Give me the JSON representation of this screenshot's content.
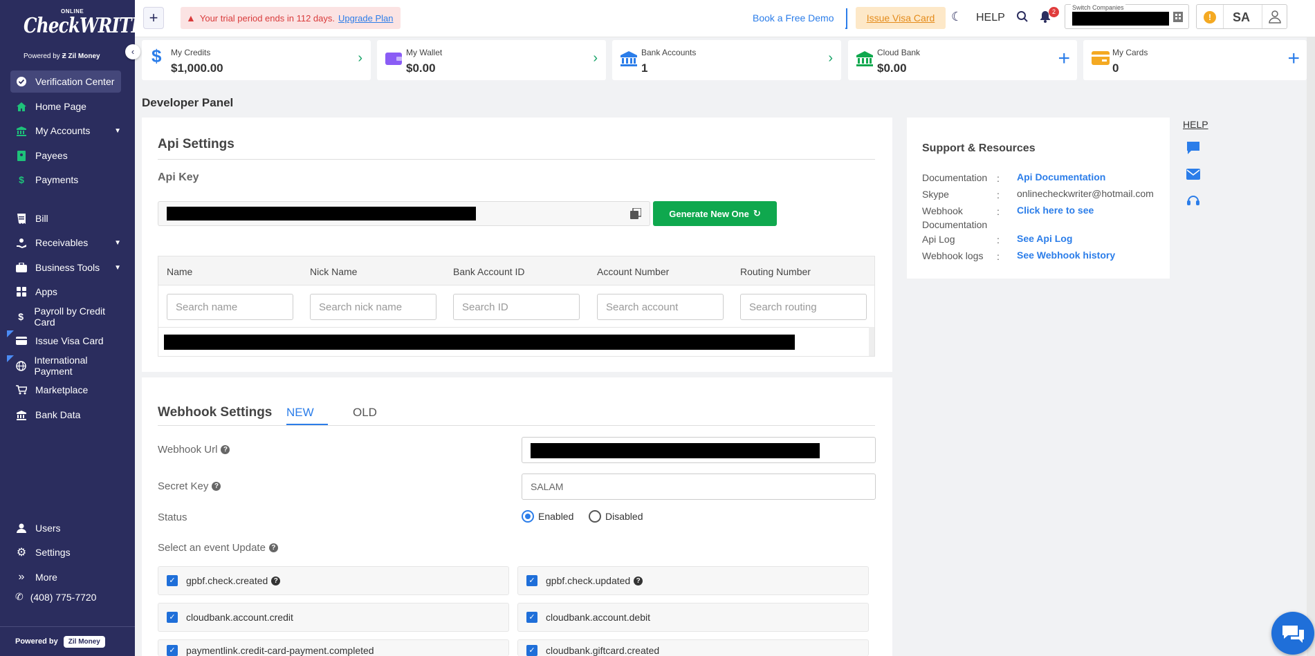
{
  "logo": {
    "online": "ONLINE",
    "brand": "CheckWRITER",
    "powered_by": "Powered by",
    "company": "Zil Money"
  },
  "sidebar": {
    "items": [
      {
        "label": "Verification Center",
        "icon": "check-circle-icon"
      },
      {
        "label": "Home Page",
        "icon": "home-icon"
      },
      {
        "label": "My Accounts",
        "icon": "bank-icon"
      },
      {
        "label": "Payees",
        "icon": "payee-icon"
      },
      {
        "label": "Payments",
        "icon": "dollar-icon"
      },
      {
        "label": "Bill",
        "icon": "bill-icon"
      },
      {
        "label": "Receivables",
        "icon": "receivables-icon"
      },
      {
        "label": "Business Tools",
        "icon": "briefcase-icon"
      },
      {
        "label": "Apps",
        "icon": "apps-icon"
      },
      {
        "label": "Payroll by Credit Card",
        "icon": "dollar-icon"
      },
      {
        "label": "Issue Visa Card",
        "icon": "card-icon"
      },
      {
        "label": "International Payment",
        "icon": "globe-icon"
      },
      {
        "label": "Marketplace",
        "icon": "cart-icon"
      },
      {
        "label": "Bank Data",
        "icon": "bank-icon"
      },
      {
        "label": "Users",
        "icon": "user-icon"
      },
      {
        "label": "Settings",
        "icon": "gear-icon"
      },
      {
        "label": "More",
        "icon": "double-chevron-icon"
      }
    ],
    "phone": "(408) 775-7720",
    "footer_powered": "Powered by",
    "footer_company": "Zil Money"
  },
  "topbar": {
    "trial_text": "Your trial period ends in 112 days.",
    "upgrade_link": "Upgrade Plan",
    "demo_link": "Book a Free Demo",
    "visa_button": "Issue Visa Card",
    "help": "HELP",
    "notification_count": "2",
    "switch_label": "Switch Companies",
    "initials": "SA",
    "alert": "!"
  },
  "cards": [
    {
      "label": "My Credits",
      "value": "$1,000.00"
    },
    {
      "label": "My Wallet",
      "value": "$0.00"
    },
    {
      "label": "Bank Accounts",
      "value": "1"
    },
    {
      "label": "Cloud Bank",
      "value": "$0.00"
    },
    {
      "label": "My Cards",
      "value": "0"
    }
  ],
  "page_title": "Developer Panel",
  "api": {
    "title": "Api Settings",
    "key_label": "Api Key",
    "generate_button": "Generate New One",
    "columns": [
      "Name",
      "Nick Name",
      "Bank Account ID",
      "Account Number",
      "Routing Number"
    ],
    "placeholders": [
      "Search name",
      "Search nick name",
      "Search ID",
      "Search account",
      "Search routing"
    ]
  },
  "webhook": {
    "title": "Webhook Settings",
    "tab_new": "NEW",
    "tab_old": "OLD",
    "url_label": "Webhook Url",
    "secret_label": "Secret Key",
    "secret_value": "SALAM",
    "status_label": "Status",
    "enabled": "Enabled",
    "disabled": "Disabled",
    "event_label": "Select an event Update",
    "events": [
      "gpbf.check.created",
      "gpbf.check.updated",
      "cloudbank.account.credit",
      "cloudbank.account.debit",
      "paymentlink.credit-card-payment.completed",
      "cloudbank.giftcard.created"
    ]
  },
  "support": {
    "title": "Support & Resources",
    "rows": [
      {
        "label": "Documentation",
        "value": "Api Documentation"
      },
      {
        "label": "Skype",
        "value": "onlinecheckwriter@hotmail.com"
      },
      {
        "label": "Webhook Documentation",
        "value": "Click here to see"
      },
      {
        "label": "Api Log",
        "value": "See Api Log"
      },
      {
        "label": "Webhook logs",
        "value": "See Webhook history"
      }
    ],
    "colon": ":"
  },
  "side_help": "HELP",
  "colors": {
    "sidebar": "#2b2d5e",
    "accent": "#2b7de9",
    "success": "#0fa84e"
  }
}
